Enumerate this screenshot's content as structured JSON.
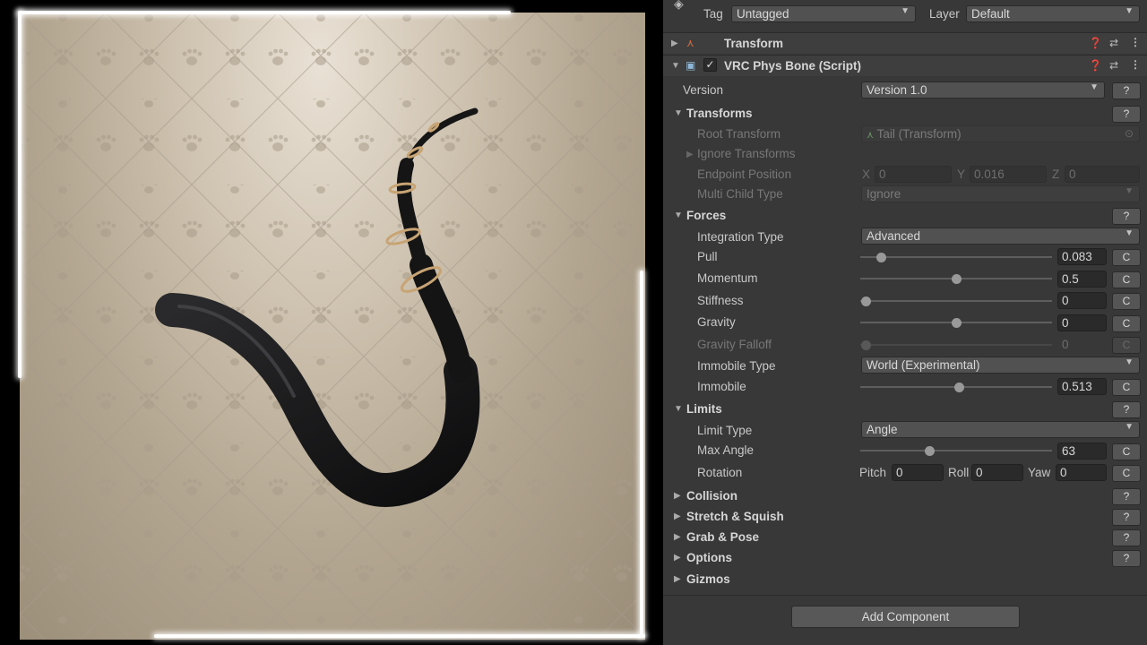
{
  "header": {
    "tag_label": "Tag",
    "tag_value": "Untagged",
    "layer_label": "Layer",
    "layer_value": "Default"
  },
  "components": {
    "transform_title": "Transform",
    "physbone_title": "VRC Phys Bone (Script)"
  },
  "version": {
    "label": "Version",
    "value": "Version 1.0"
  },
  "transforms": {
    "title": "Transforms",
    "root_label": "Root Transform",
    "root_value": "Tail (Transform)",
    "ignore_label": "Ignore Transforms",
    "endpoint_label": "Endpoint Position",
    "endpoint_x_label": "X",
    "endpoint_x": "0",
    "endpoint_y_label": "Y",
    "endpoint_y": "0.016",
    "endpoint_z_label": "Z",
    "endpoint_z": "0",
    "multi_label": "Multi Child Type",
    "multi_value": "Ignore"
  },
  "forces": {
    "title": "Forces",
    "integration_label": "Integration Type",
    "integration_value": "Advanced",
    "pull_label": "Pull",
    "pull_value": "0.083",
    "pull_level": 0.083,
    "momentum_label": "Momentum",
    "momentum_value": "0.5",
    "momentum_level": 0.5,
    "stiffness_label": "Stiffness",
    "stiffness_value": "0",
    "stiffness_level": 0,
    "gravity_label": "Gravity",
    "gravity_value": "0",
    "gravity_level": 0.5,
    "gravity_falloff_label": "Gravity Falloff",
    "gravity_falloff_value": "0",
    "gravity_falloff_level": 0,
    "immobile_type_label": "Immobile Type",
    "immobile_type_value": "World (Experimental)",
    "immobile_label": "Immobile",
    "immobile_value": "0.513",
    "immobile_level": 0.513
  },
  "limits": {
    "title": "Limits",
    "type_label": "Limit Type",
    "type_value": "Angle",
    "max_angle_label": "Max Angle",
    "max_angle_value": "63",
    "max_angle_level": 0.35,
    "rotation_label": "Rotation",
    "pitch_label": "Pitch",
    "pitch_value": "0",
    "roll_label": "Roll",
    "roll_value": "0",
    "yaw_label": "Yaw",
    "yaw_value": "0"
  },
  "sections": {
    "collision": "Collision",
    "stretch": "Stretch & Squish",
    "grab": "Grab & Pose",
    "options": "Options",
    "gizmos": "Gizmos"
  },
  "buttons": {
    "help": "?",
    "clear": "C",
    "add_component": "Add Component",
    "checkbox": "✓"
  },
  "colors": {
    "inspector_bg": "#383838",
    "wall_base": "#c6b9a5",
    "tail": "#141414",
    "ring": "#c8a474"
  }
}
